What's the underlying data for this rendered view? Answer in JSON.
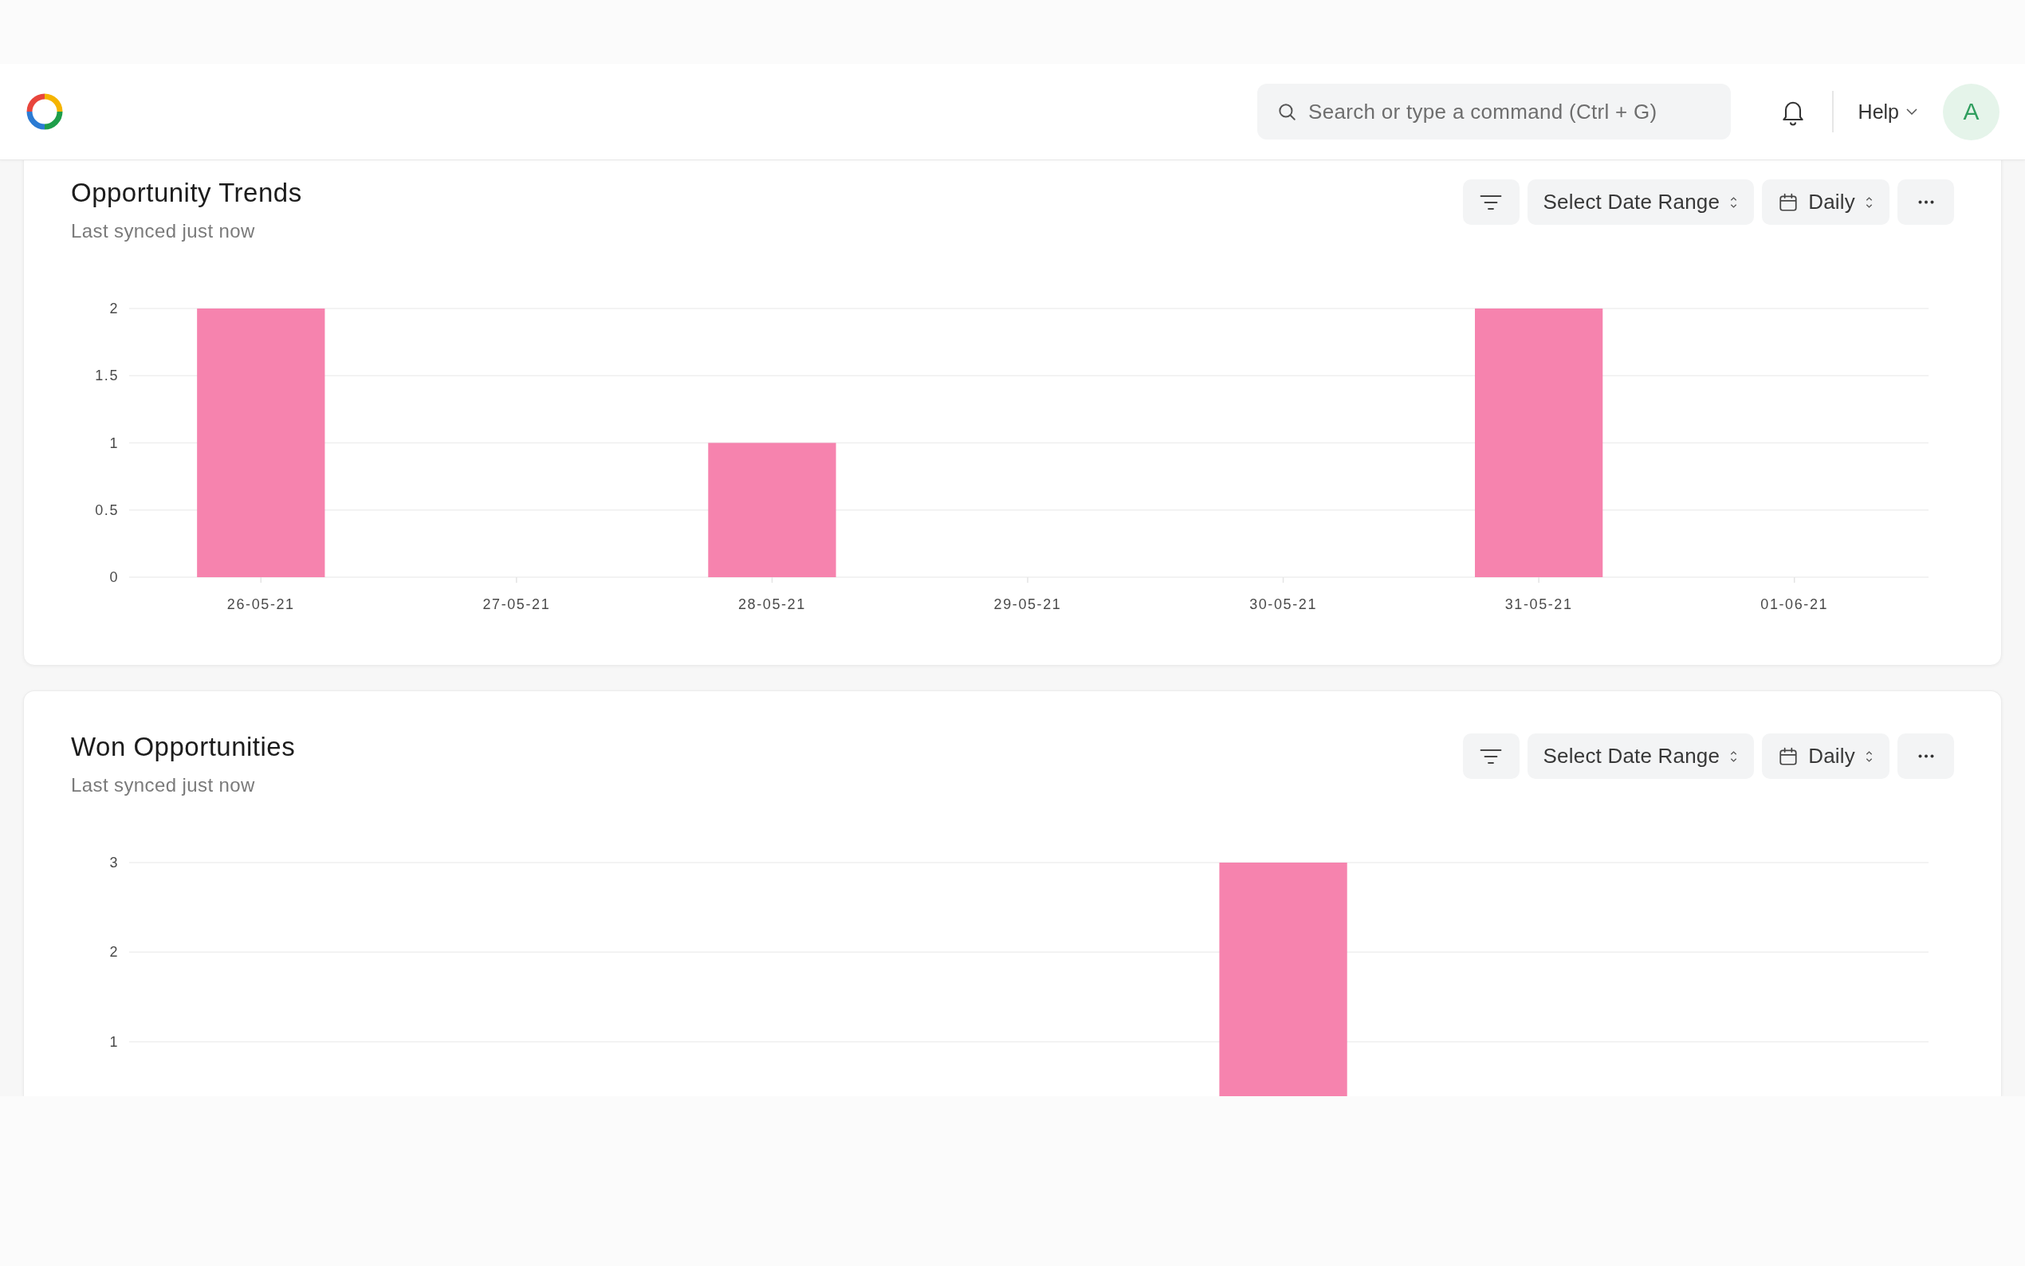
{
  "navbar": {
    "search": {
      "placeholder": "Search or type a command (Ctrl + G)"
    },
    "help": "Help",
    "avatar": "A"
  },
  "cards": [
    {
      "title": "Opportunity Trends",
      "subtitle": "Last synced just now",
      "actions": [
        {
          "kind": "filter"
        },
        {
          "kind": "range",
          "label": "Select Date Range"
        },
        {
          "kind": "interval",
          "label": "Daily"
        },
        {
          "kind": "menu"
        }
      ],
      "chart_data": {
        "type": "bar",
        "categories": [
          "26-05-21",
          "27-05-21",
          "28-05-21",
          "29-05-21",
          "30-05-21",
          "31-05-21",
          "01-06-21"
        ],
        "values": [
          2,
          0,
          1,
          0,
          0,
          2,
          0
        ],
        "ylim": [
          0,
          2
        ],
        "yticks": [
          0,
          0.5,
          1,
          1.5,
          2
        ],
        "grid": true
      }
    },
    {
      "title": "Won Opportunities",
      "subtitle": "Last synced just now",
      "actions": [
        {
          "kind": "filter"
        },
        {
          "kind": "range",
          "label": "Select Date Range"
        },
        {
          "kind": "interval",
          "label": "Daily"
        },
        {
          "kind": "menu"
        }
      ],
      "chart_data": {
        "type": "bar",
        "values": [
          0,
          0,
          0,
          0,
          3,
          0,
          0
        ],
        "ylim": [
          0,
          3
        ],
        "yticks": [
          1,
          2,
          3
        ],
        "grid": true
      }
    }
  ]
}
